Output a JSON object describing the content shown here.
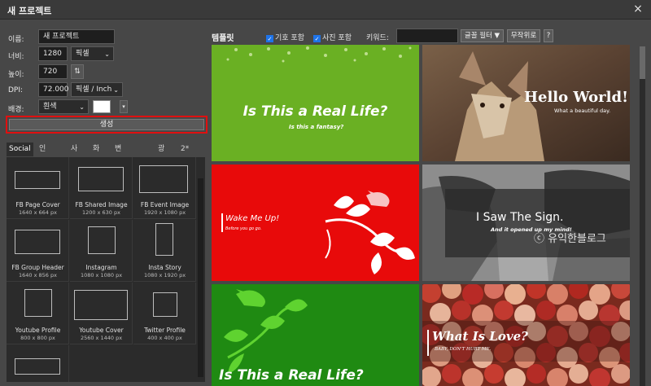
{
  "window": {
    "title": "새 프로젝트",
    "close_glyph": "×"
  },
  "form": {
    "name_label": "이름:",
    "name_value": "새 프로젝트",
    "width_label": "너비:",
    "width_value": "1280",
    "width_unit": "픽셀",
    "height_label": "높이:",
    "height_value": "720",
    "swap_glyph": "⇅",
    "dpi_label": "DPI:",
    "dpi_value": "72.000",
    "dpi_unit": "픽셀 / Inch",
    "bg_label": "배경:",
    "bg_value": "흰색",
    "bg_color": "#ffffff",
    "create_label": "생성",
    "highlight_color": "#e01010"
  },
  "tabs": [
    "Social",
    "인쇄 된",
    "사진",
    "화면",
    "변하기 쉬운",
    "광고",
    "2*"
  ],
  "presets": [
    {
      "name": "FB Page Cover",
      "size": "1640 x 664 px"
    },
    {
      "name": "FB Shared Image",
      "size": "1200 x 630 px"
    },
    {
      "name": "FB Event Image",
      "size": "1920 x 1080 px"
    },
    {
      "name": "FB Group Header",
      "size": "1640 x 856 px"
    },
    {
      "name": "Instagram",
      "size": "1080 x 1080 px"
    },
    {
      "name": "Insta Story",
      "size": "1080 x 1920 px"
    },
    {
      "name": "Youtube Profile",
      "size": "800 x 800 px"
    },
    {
      "name": "Youtube Cover",
      "size": "2560 x 1440 px"
    },
    {
      "name": "Twitter Profile",
      "size": "400 x 400 px"
    },
    {
      "name": "",
      "size": ""
    }
  ],
  "templates_panel": {
    "title": "템플릿",
    "symbols_label": "기호 포함",
    "photos_label": "사진 포함",
    "keyword_label": "키워드:",
    "keyword_value": "",
    "font_filter_label": "글꼴 필터 ▼",
    "random_label": "무작위로",
    "help_label": "?"
  },
  "templates": [
    {
      "title": "Is This a Real Life?",
      "subtitle": "Is this a fantasy?",
      "bg": "#6ab023"
    },
    {
      "title": "Hello World!",
      "subtitle": "What a beautiful day."
    },
    {
      "title": "Wake Me Up!",
      "subtitle": "Before you go go.",
      "bg": "#e80a0a"
    },
    {
      "title": "I Saw The Sign.",
      "subtitle": "And it opened up my mind!"
    },
    {
      "title": "Is This a Real Life?",
      "subtitle": "",
      "bg": "#1f8a12"
    },
    {
      "title": "What Is Love?",
      "subtitle": "BABY, DON'T HURT ME."
    }
  ],
  "watermark": "ⓒ 유익한블로그"
}
